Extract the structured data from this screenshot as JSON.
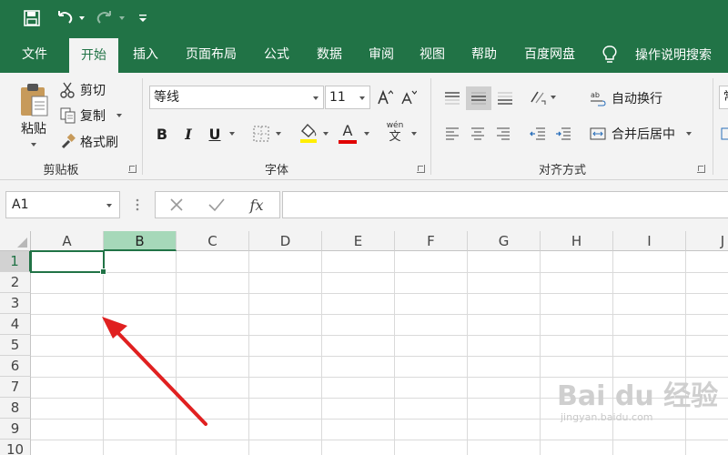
{
  "quick_access": {
    "save_icon": "save-icon",
    "undo_icon": "undo-icon",
    "redo_icon": "redo-icon",
    "customize_icon": "customize-qat-icon"
  },
  "menu": {
    "tabs": [
      {
        "label": "文件",
        "active": false
      },
      {
        "label": "开始",
        "active": true
      },
      {
        "label": "插入",
        "active": false
      },
      {
        "label": "页面布局",
        "active": false
      },
      {
        "label": "公式",
        "active": false
      },
      {
        "label": "数据",
        "active": false
      },
      {
        "label": "审阅",
        "active": false
      },
      {
        "label": "视图",
        "active": false
      },
      {
        "label": "帮助",
        "active": false
      },
      {
        "label": "百度网盘",
        "active": false
      }
    ],
    "tell_me": "操作说明搜索"
  },
  "ribbon": {
    "clipboard": {
      "paste": "粘贴",
      "cut": "剪切",
      "copy": "复制",
      "format_painter": "格式刷",
      "group_label": "剪贴板"
    },
    "font": {
      "font_name": "等线",
      "font_size": "11",
      "group_label": "字体",
      "bold": "B",
      "italic": "I",
      "underline": "U",
      "font_color_letter": "A",
      "phonetic": "wén",
      "phonetic_char": "文"
    },
    "alignment": {
      "wrap_text": "自动换行",
      "merge_center": "合并后居中",
      "group_label": "对齐方式"
    },
    "number": {
      "partial_label": "常"
    }
  },
  "formula_bar": {
    "name_box": "A1",
    "fx": "fx",
    "value": ""
  },
  "sheet": {
    "columns": [
      "A",
      "B",
      "C",
      "D",
      "E",
      "F",
      "G",
      "H",
      "I",
      "J"
    ],
    "rows": [
      "1",
      "2",
      "3",
      "4",
      "5",
      "6",
      "7",
      "8",
      "9",
      "10"
    ],
    "active_cell": "A1",
    "highlighted_column": "B"
  },
  "watermark": {
    "main": "Bai du 经验",
    "sub": "jingyan.baidu.com"
  },
  "colors": {
    "accent": "#217346",
    "arrow": "#e02020",
    "highlight_col": "#a6d8b9"
  }
}
